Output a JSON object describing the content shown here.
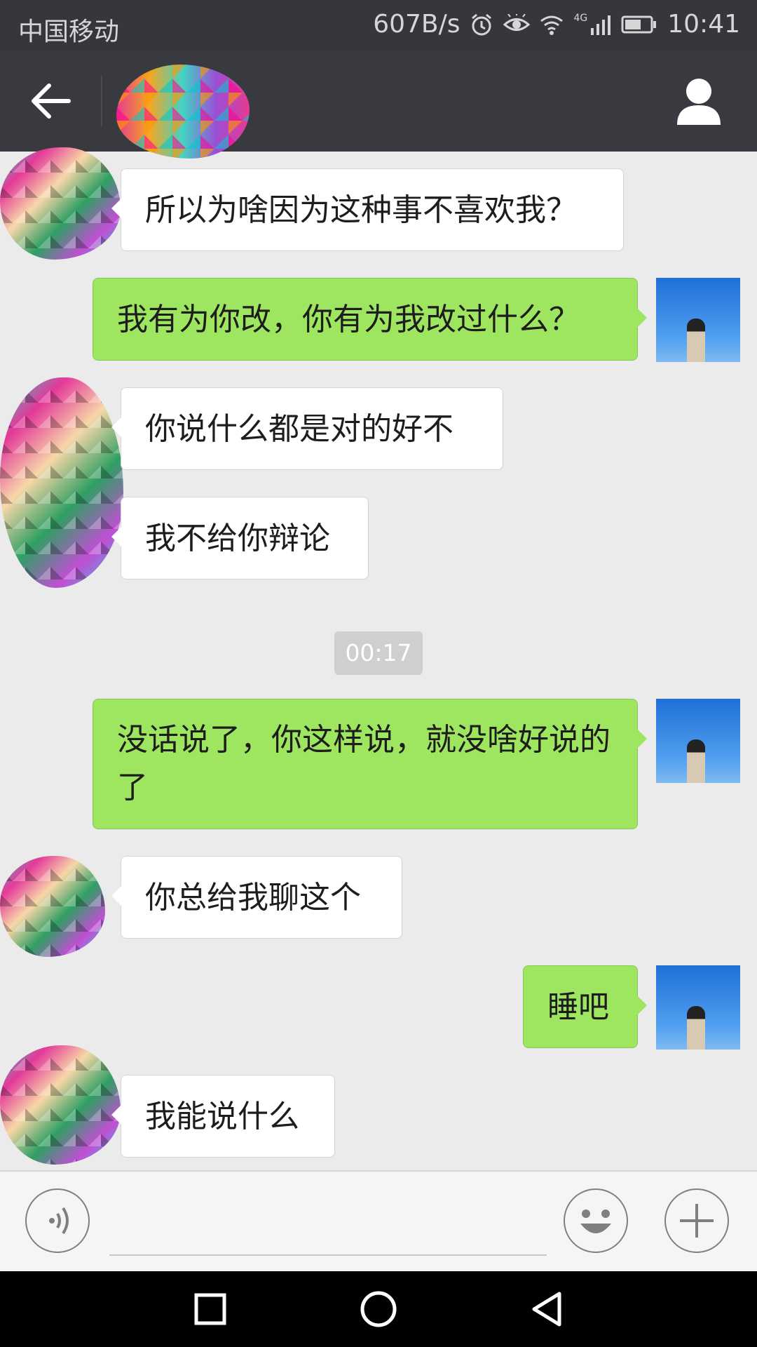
{
  "status_bar": {
    "carrier": "中国移动",
    "net_speed": "607B/s",
    "network": "4G",
    "time": "10:41",
    "icons": [
      "alarm-icon",
      "eye-icon",
      "wifi-icon",
      "signal-icon",
      "battery-icon"
    ]
  },
  "title_bar": {
    "icons": [
      "back-arrow-icon",
      "contact-avatar",
      "profile-icon"
    ]
  },
  "chat": {
    "messages": [
      {
        "side": "in",
        "text": "所以为啥因为这种事不喜欢我？"
      },
      {
        "side": "out",
        "text": "我有为你改，你有为我改过什么？"
      },
      {
        "side": "in",
        "text": "你说什么都是对的好不"
      },
      {
        "side": "in",
        "text": "我不给你辩论"
      },
      {
        "side": "out",
        "text": "没话说了，你这样说，就没啥好说的了"
      },
      {
        "side": "in",
        "text": "你总给我聊这个"
      },
      {
        "side": "out",
        "text": "睡吧"
      },
      {
        "side": "in",
        "text": "我能说什么"
      }
    ],
    "timestamp": "00:17"
  },
  "input_bar": {
    "text_value": "",
    "icons": [
      "voice-icon",
      "emoji-icon",
      "plus-icon"
    ]
  },
  "nav_bar": {
    "icons": [
      "recents-icon",
      "home-icon",
      "back-icon"
    ]
  },
  "colors": {
    "status_bar_bg": "#36373b",
    "title_bar_bg": "#393a3f",
    "chat_bg": "#ebebeb",
    "incoming_bubble": "#ffffff",
    "outgoing_bubble": "#9fe660"
  }
}
